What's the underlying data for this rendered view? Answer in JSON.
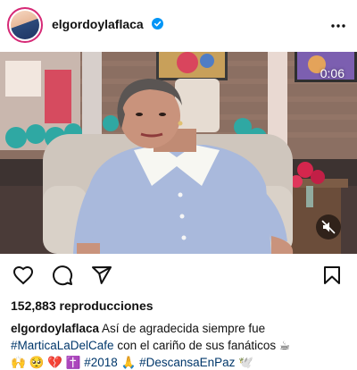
{
  "header": {
    "username": "elgordoylaflaca"
  },
  "media": {
    "timer": "0:06"
  },
  "stats": {
    "views": "152,883 reproducciones"
  },
  "caption": {
    "username": "elgordoylaflaca",
    "text1": " Así de agradecida siempre fue",
    "hashtag1": "#MarticaLaDelCafe",
    "text2": " con el cariño de sus fanáticos ☕",
    "emojis1": "🙌 🥺 💔 ✝️ ",
    "hashtag2": "#2018",
    "emojis2": " 🙏 ",
    "hashtag3": "#DescansaEnPaz",
    "emojis3": " 🕊️"
  },
  "colors": {
    "link": "#00376b",
    "verified": "#0095f6",
    "avatar_ring": "#d62976"
  },
  "icons": [
    "verified-badge-icon",
    "more-icon",
    "mute-icon",
    "heart-icon",
    "comment-icon",
    "share-icon",
    "bookmark-icon"
  ]
}
